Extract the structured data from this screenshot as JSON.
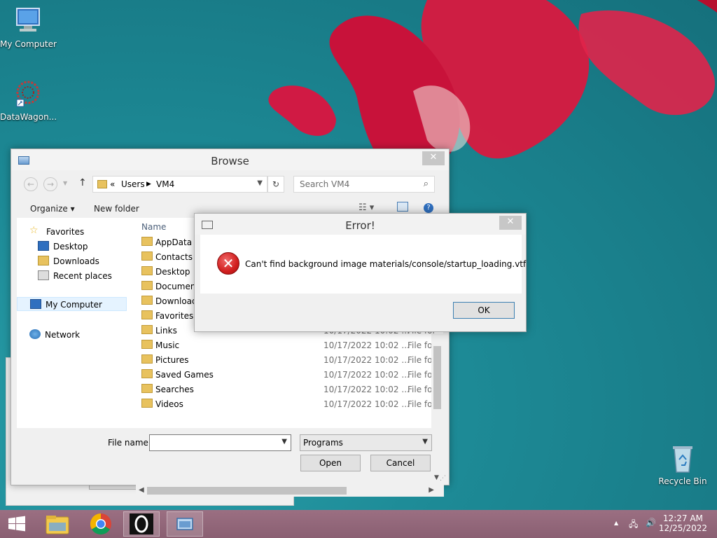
{
  "desktop": {
    "icons": [
      {
        "label": "My Computer"
      },
      {
        "label": "DataWagon..."
      },
      {
        "label": "Recycle Bin"
      }
    ]
  },
  "browse": {
    "title": "Browse",
    "address": {
      "prefix": "«",
      "crumbs": [
        "Users",
        "VM4"
      ]
    },
    "search_placeholder": "Search VM4",
    "toolbar": {
      "organize": "Organize ▾",
      "new_folder": "New folder"
    },
    "nav": {
      "favorites": "Favorites",
      "desktop": "Desktop",
      "downloads": "Downloads",
      "recent": "Recent places",
      "my_computer": "My Computer",
      "network": "Network"
    },
    "columns": {
      "name": "Name"
    },
    "rows": [
      {
        "name": "AppData",
        "date": "",
        "type": ""
      },
      {
        "name": "Contacts",
        "date": "",
        "type": ""
      },
      {
        "name": "Desktop",
        "date": "",
        "type": ""
      },
      {
        "name": "Document",
        "date": "",
        "type": ""
      },
      {
        "name": "Download",
        "date": "",
        "type": ""
      },
      {
        "name": "Favorites",
        "date": "",
        "type": ""
      },
      {
        "name": "Links",
        "date": "10/17/2022 10:02 ...",
        "type": "File fol"
      },
      {
        "name": "Music",
        "date": "10/17/2022 10:02 ...",
        "type": "File fol"
      },
      {
        "name": "Pictures",
        "date": "10/17/2022 10:02 ...",
        "type": "File fol"
      },
      {
        "name": "Saved Games",
        "date": "10/17/2022 10:02 ...",
        "type": "File fol"
      },
      {
        "name": "Searches",
        "date": "10/17/2022 10:02 ...",
        "type": "File fol"
      },
      {
        "name": "Videos",
        "date": "10/17/2022 10:02 ...",
        "type": "File fol"
      }
    ],
    "file_name_label": "File name:",
    "file_name_value": "",
    "file_type": "Programs",
    "open": "Open",
    "cancel": "Cancel"
  },
  "error": {
    "title": "Error!",
    "message": "Can't find background image materials/console/startup_loading.vtf",
    "ok": "OK"
  },
  "taskbar": {
    "time": "12:27 AM",
    "date": "12/25/2022"
  }
}
